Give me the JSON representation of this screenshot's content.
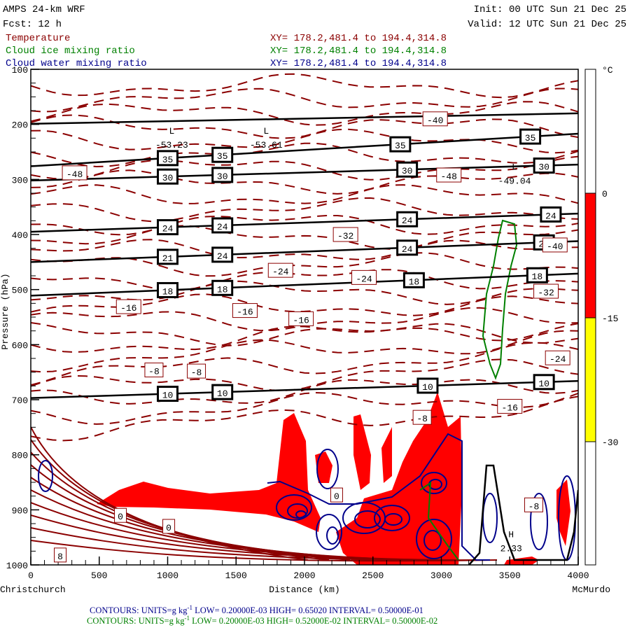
{
  "header": {
    "model": "AMPS 24-km WRF",
    "forecast": "Fcst:   12 h",
    "init": "Init: 00 UTC Sun 21 Dec 25",
    "valid": "Valid: 12 UTC Sun 21 Dec 25"
  },
  "fields": [
    {
      "name": "Temperature",
      "xy": "XY= 178.2,481.4 to 194.4,314.8",
      "color": "#8b0000"
    },
    {
      "name": "Cloud ice mixing ratio",
      "xy": "XY= 178.2,481.4 to 194.4,314.8",
      "color": "#008000"
    },
    {
      "name": "Cloud water mixing ratio",
      "xy": "XY= 178.2,481.4 to 194.4,314.8",
      "color": "#00008b"
    }
  ],
  "colorbar": {
    "unit": "°C",
    "labels": [
      "0",
      "-15",
      "-30"
    ],
    "bands": [
      {
        "from": 0,
        "to": -15,
        "color": "#ff0000"
      },
      {
        "from": -15,
        "to": -30,
        "color": "#ffff00"
      }
    ]
  },
  "footer": {
    "line1": "CONTOURS:  UNITS=g kg",
    "line1_rest": " LOW= 0.20000E-03   HIGH= 0.65020      INTERVAL=  0.50000E-01",
    "line2": "CONTOURS:  UNITS=g kg",
    "line2_rest": " LOW= 0.20000E-03  HIGH= 0.52000E-02  INTERVAL=  0.50000E-02",
    "sup": "-1"
  },
  "chart_data": {
    "type": "line",
    "title": "AMPS 24-km WRF cross section",
    "xlabel": "Distance (km)",
    "ylabel": "Pressure (hPa)",
    "xlim": [
      0,
      4000
    ],
    "ylim": [
      1000,
      100
    ],
    "x_ticks": [
      "0",
      "500",
      "1000",
      "1500",
      "2000",
      "2500",
      "3000",
      "3500",
      "4000"
    ],
    "y_ticks": [
      "100",
      "200",
      "300",
      "400",
      "500",
      "600",
      "700",
      "800",
      "900",
      "1000"
    ],
    "x_endpoints": {
      "left": "Christchurch",
      "right": "McMurdo"
    },
    "black_lines": [
      {
        "p_start": 199,
        "p_end": 180,
        "labels": []
      },
      {
        "p_start": 276,
        "p_end": 217,
        "labels": [
          {
            "x": 1000,
            "v": "35"
          },
          {
            "x": 1400,
            "v": "35"
          },
          {
            "x": 2700,
            "v": "35"
          },
          {
            "x": 3650,
            "v": "35"
          }
        ]
      },
      {
        "p_start": 302,
        "p_end": 273,
        "labels": [
          {
            "x": 1000,
            "v": "30"
          },
          {
            "x": 1400,
            "v": "30"
          },
          {
            "x": 2750,
            "v": "30"
          },
          {
            "x": 3750,
            "v": "30"
          }
        ]
      },
      {
        "p_start": 395,
        "p_end": 362,
        "labels": [
          {
            "x": 1000,
            "v": "24"
          },
          {
            "x": 1400,
            "v": "24"
          },
          {
            "x": 2750,
            "v": "24"
          },
          {
            "x": 3800,
            "v": "24"
          }
        ]
      },
      {
        "p_start": 450,
        "p_end": 412,
        "labels": [
          {
            "x": 1000,
            "v": "21"
          },
          {
            "x": 1400,
            "v": "24"
          },
          {
            "x": 2750,
            "v": "24"
          },
          {
            "x": 3750,
            "v": "21"
          }
        ]
      },
      {
        "p_start": 511,
        "p_end": 471,
        "labels": [
          {
            "x": 1000,
            "v": "18"
          },
          {
            "x": 1400,
            "v": "18"
          },
          {
            "x": 2800,
            "v": "18"
          },
          {
            "x": 3700,
            "v": "18"
          }
        ]
      },
      {
        "p_start": 697,
        "p_end": 666,
        "labels": [
          {
            "x": 1000,
            "v": "10"
          },
          {
            "x": 1400,
            "v": "10"
          },
          {
            "x": 2900,
            "v": "10"
          },
          {
            "x": 3750,
            "v": "10"
          }
        ]
      }
    ],
    "temperature_labels": [
      {
        "x": 320,
        "p": 288,
        "v": "-48"
      },
      {
        "x": 2955,
        "p": 190,
        "v": "-40"
      },
      {
        "x": 3055,
        "p": 292,
        "v": "-48"
      },
      {
        "x": 2300,
        "p": 400,
        "v": "-32"
      },
      {
        "x": 1825,
        "p": 465,
        "v": "-24"
      },
      {
        "x": 2435,
        "p": 478,
        "v": "-24"
      },
      {
        "x": 715,
        "p": 531,
        "v": "-16"
      },
      {
        "x": 1565,
        "p": 538,
        "v": "-16"
      },
      {
        "x": 1975,
        "p": 553,
        "v": "-16"
      },
      {
        "x": 900,
        "p": 646,
        "v": "-8"
      },
      {
        "x": 1210,
        "p": 648,
        "v": "-8"
      },
      {
        "x": 2860,
        "p": 732,
        "v": "-8"
      },
      {
        "x": 3500,
        "p": 712,
        "v": "-16"
      },
      {
        "x": 3850,
        "p": 624,
        "v": "-24"
      },
      {
        "x": 3765,
        "p": 503,
        "v": "-32"
      },
      {
        "x": 3830,
        "p": 419,
        "v": "-40"
      },
      {
        "x": 2235,
        "p": 873,
        "v": "0"
      },
      {
        "x": 655,
        "p": 910,
        "v": "0"
      },
      {
        "x": 1008,
        "p": 930,
        "v": "0"
      },
      {
        "x": 215,
        "p": 982,
        "v": "8"
      },
      {
        "x": 3675,
        "p": 891,
        "v": "-8"
      }
    ],
    "extrema": [
      {
        "type": "L",
        "x": 1030,
        "p": 237,
        "v": "-53.23"
      },
      {
        "type": "L",
        "x": 1720,
        "p": 237,
        "v": "-53.61"
      },
      {
        "type": "L",
        "x": 3535,
        "p": 303,
        "v": "-49.04"
      },
      {
        "type": "H",
        "x": 3510,
        "p": 970,
        "v": "2.33"
      }
    ],
    "grid": false
  }
}
